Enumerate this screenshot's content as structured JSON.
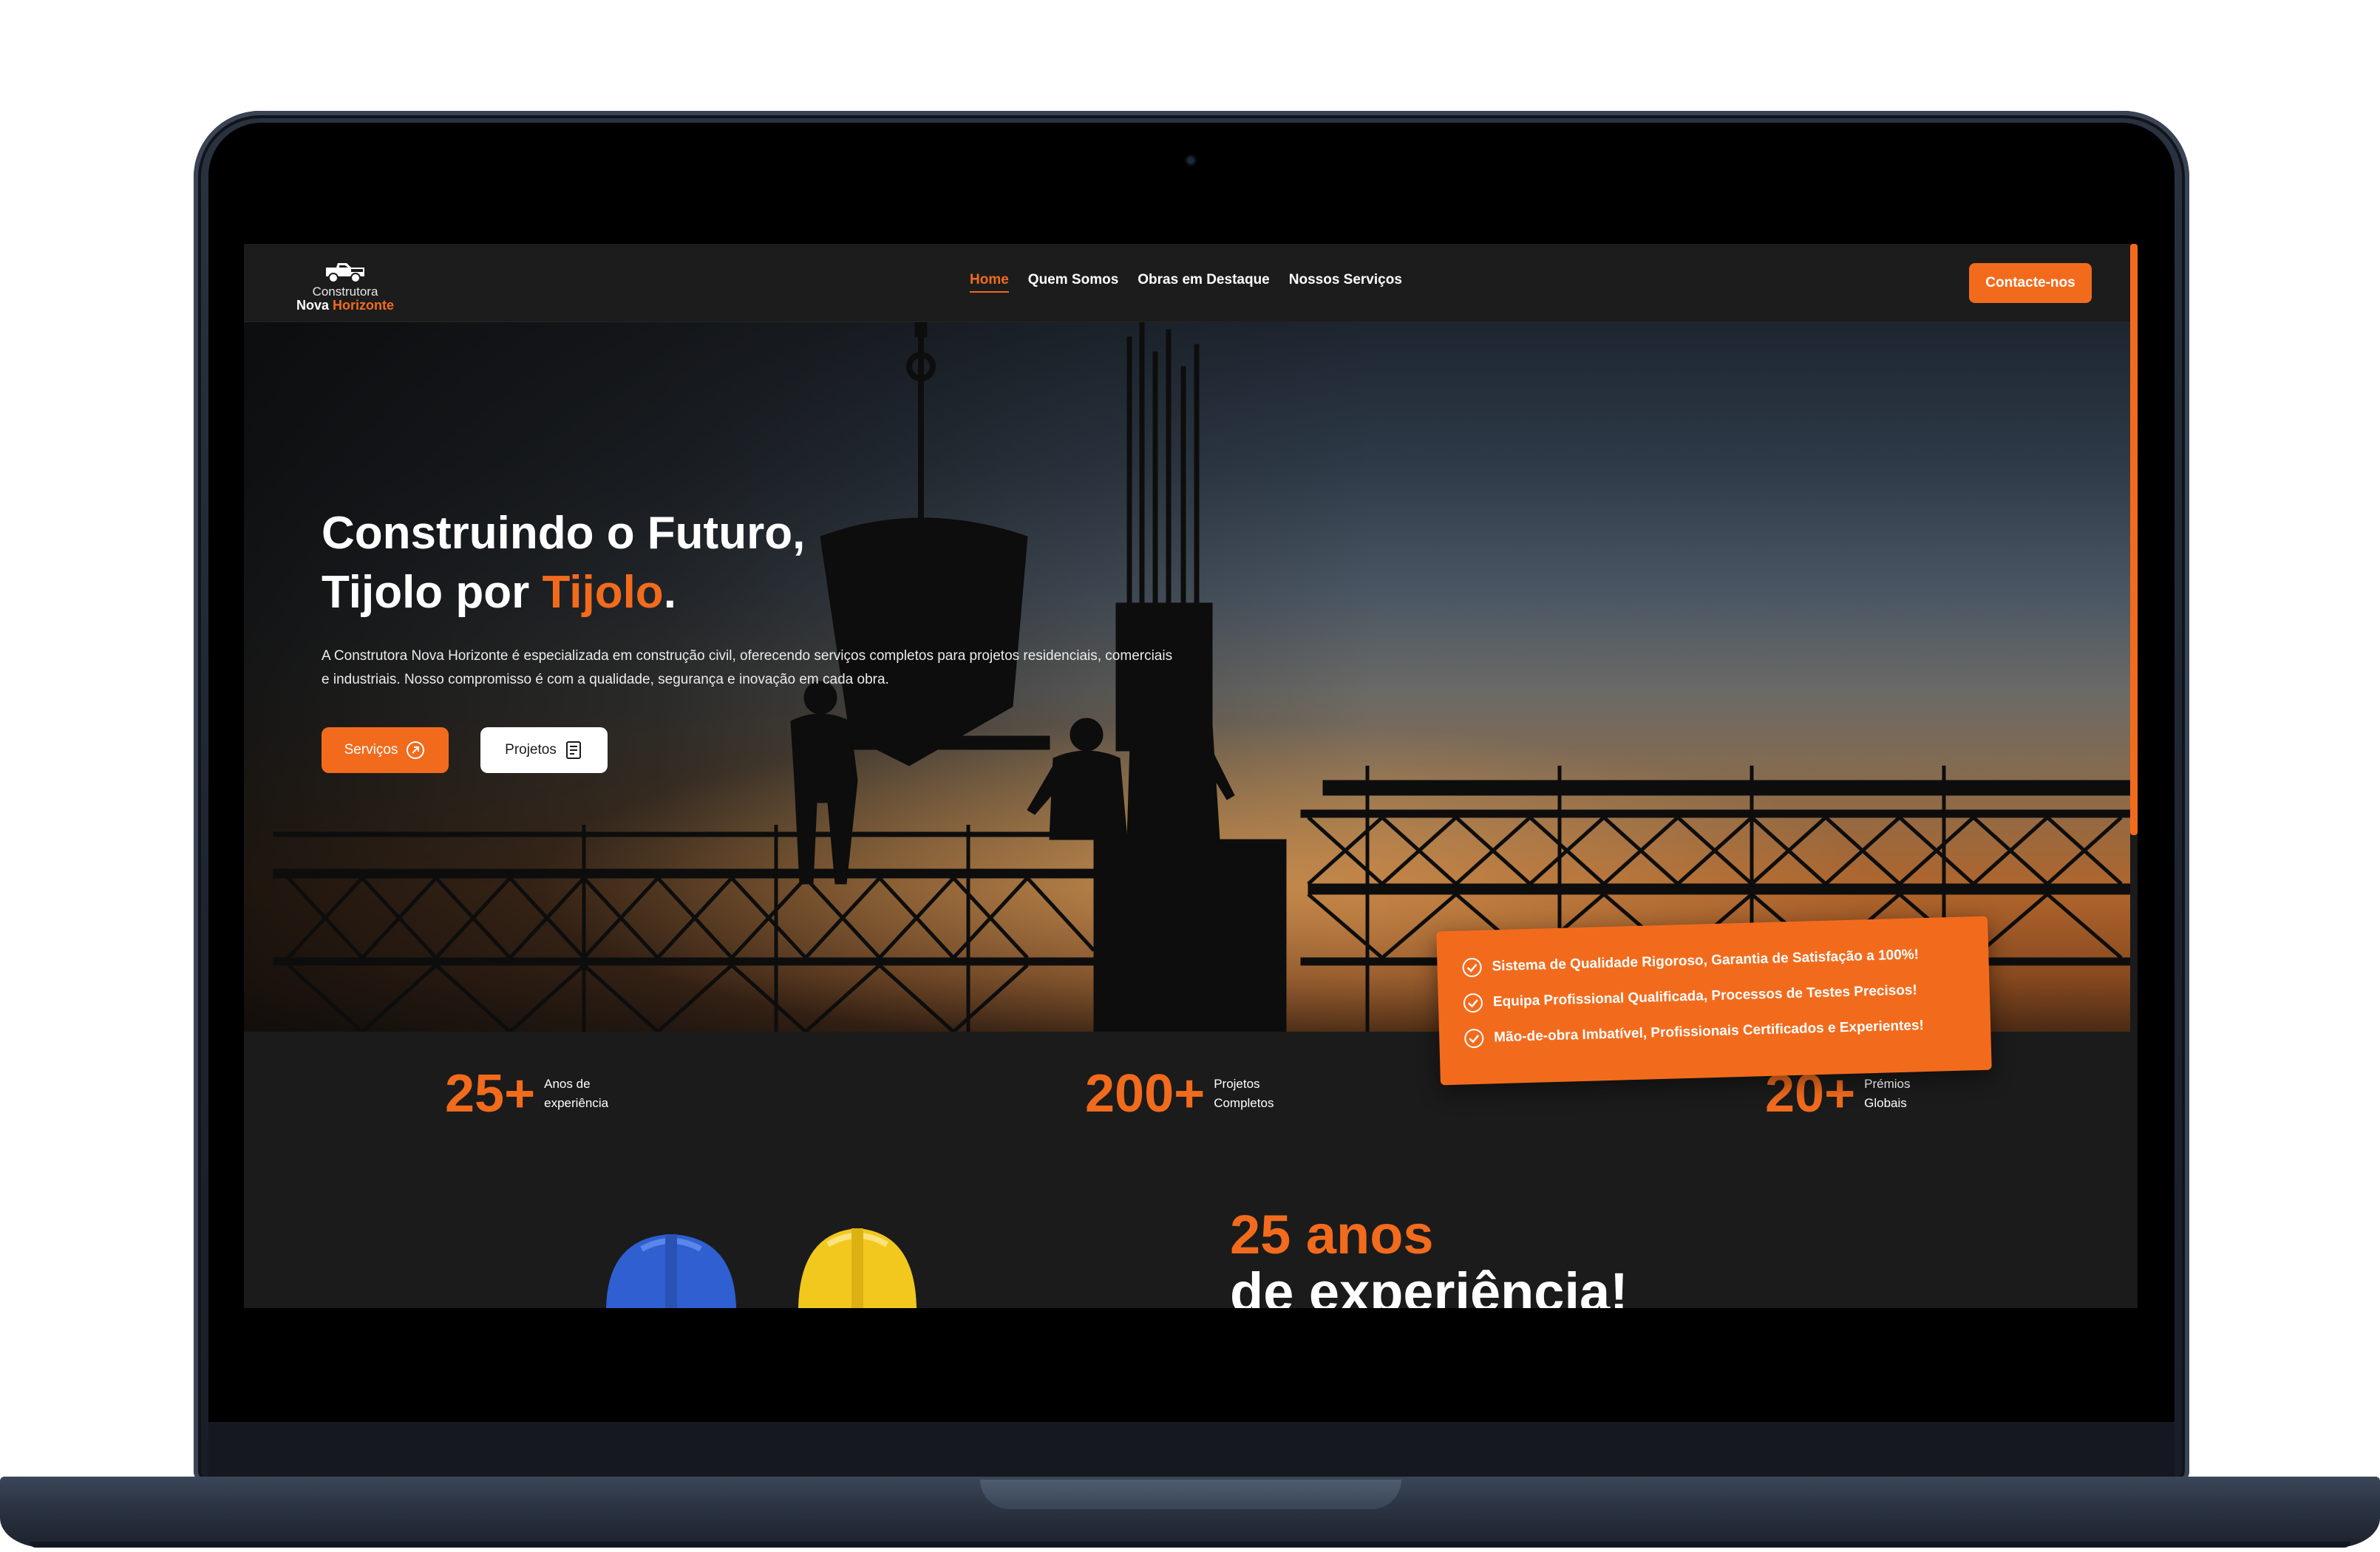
{
  "brand": {
    "line1": "Construtora",
    "line2_prefix": "Nova",
    "line2_accent": "Horizonte",
    "accent_color": "#f26b1d"
  },
  "nav": {
    "links": [
      "Home",
      "Quem Somos",
      "Obras em Destaque",
      "Nossos Serviços"
    ],
    "active": "Home",
    "contact_label": "Contacte-nos"
  },
  "hero": {
    "title_line1": "Construindo o Futuro,",
    "title_line2_prefix": "Tijolo por ",
    "title_line2_accent": "Tijolo",
    "title_line2_suffix": ".",
    "description": "A Construtora Nova Horizonte é especializada em construção civil, oferecendo serviços completos para projetos residenciais, comerciais e industriais. Nosso compromisso é com a qualidade, segurança e inovação em cada obra.",
    "btn_services": "Serviços",
    "btn_projects": "Projetos"
  },
  "features": [
    "Sistema de Qualidade Rigoroso, Garantia de Satisfação a 100%!",
    "Equipa Profissional Qualificada, Processos de Testes Precisos!",
    "Mão-de-obra Imbatível, Profissionais Certificados e Experientes!"
  ],
  "stats": [
    {
      "value": "25+",
      "label1": "Anos de",
      "label2": "experiência"
    },
    {
      "value": "200+",
      "label1": "Projetos",
      "label2": "Completos"
    },
    {
      "value": "20+",
      "label1": "Prémios",
      "label2": "Globais"
    }
  ],
  "about": {
    "title_line1": "25 anos",
    "title_line2": "de experiência!"
  },
  "icons": {
    "services": "arrow-up-right-circle-icon",
    "projects": "document-icon",
    "feature": "check-circle-icon",
    "logo": "truck-logo-icon"
  }
}
